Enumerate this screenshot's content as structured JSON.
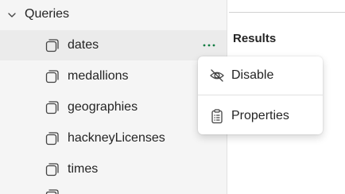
{
  "queries_group": {
    "label": "Queries",
    "items": [
      {
        "name": "dates",
        "selected": true
      },
      {
        "name": "medallions"
      },
      {
        "name": "geographies"
      },
      {
        "name": "hackneyLicenses"
      },
      {
        "name": "times"
      }
    ],
    "more_icon": "ellipsis-icon"
  },
  "results": {
    "title": "Results"
  },
  "context_menu": {
    "items": [
      {
        "label": "Disable",
        "icon": "eye-off-icon"
      },
      {
        "label": "Properties",
        "icon": "clipboard-list-icon"
      }
    ]
  },
  "colors": {
    "accent": "#107c41",
    "pane_bg": "#f5f5f5",
    "selected_row_bg": "#ebebeb"
  }
}
